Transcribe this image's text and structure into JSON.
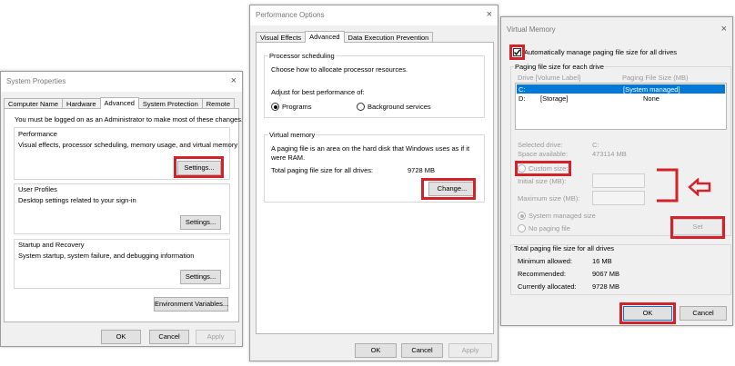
{
  "sys": {
    "title": "System Properties",
    "close": "×",
    "tabs": [
      "Computer Name",
      "Hardware",
      "Advanced",
      "System Protection",
      "Remote"
    ],
    "admin_note": "You must be logged on as an Administrator to make most of these changes.",
    "perf_title": "Performance",
    "perf_desc": "Visual effects, processor scheduling, memory usage, and virtual memory",
    "settings_label": "Settings...",
    "profiles_title": "User Profiles",
    "profiles_desc": "Desktop settings related to your sign-in",
    "startup_title": "Startup and Recovery",
    "startup_desc": "System startup, system failure, and debugging information",
    "env_label": "Environment Variables...",
    "ok": "OK",
    "cancel": "Cancel",
    "apply": "Apply"
  },
  "perf": {
    "title": "Performance Options",
    "close": "×",
    "tabs": [
      "Visual Effects",
      "Advanced",
      "Data Execution Prevention"
    ],
    "sched_title": "Processor scheduling",
    "sched_desc": "Choose how to allocate processor resources.",
    "adjust_label": "Adjust for best performance of:",
    "programs": "Programs",
    "background": "Background services",
    "vm_title": "Virtual memory",
    "vm_desc_1": "A paging file is an area on the hard disk that Windows uses as if it",
    "vm_desc_2": "were RAM.",
    "total_label": "Total paging file size for all drives:",
    "total_value": "9728 MB",
    "change": "Change...",
    "ok": "OK",
    "cancel": "Cancel",
    "apply": "Apply"
  },
  "vm": {
    "title": "Virtual Memory",
    "close": "×",
    "auto_label": "Automatically manage paging file size for all drives",
    "each_title": "Paging file size for each drive",
    "col_drive": "Drive  [Volume Label]",
    "col_size": "Paging File Size (MB)",
    "row_c_drive": "C:",
    "row_c_size": "[System managed]",
    "row_d_drive": "D:",
    "row_d_label": "[Storage]",
    "row_d_size": "None",
    "sel_drive_label": "Selected drive:",
    "sel_drive_value": "C:",
    "space_label": "Space available:",
    "space_value": "473114 MB",
    "custom": "Custom size:",
    "initial": "Initial size (MB):",
    "maximum": "Maximum size (MB):",
    "system_managed": "System managed size",
    "no_paging": "No paging file",
    "set": "Set",
    "total_title": "Total paging file size for all drives",
    "min_label": "Minimum allowed:",
    "min_value": "16 MB",
    "rec_label": "Recommended:",
    "rec_value": "9067 MB",
    "cur_label": "Currently allocated:",
    "cur_value": "9728 MB",
    "ok": "OK",
    "cancel": "Cancel"
  },
  "colors": {
    "highlight": "#d3222a",
    "selection": "#0078d7",
    "dialog_bg": "#f0f0f0"
  }
}
